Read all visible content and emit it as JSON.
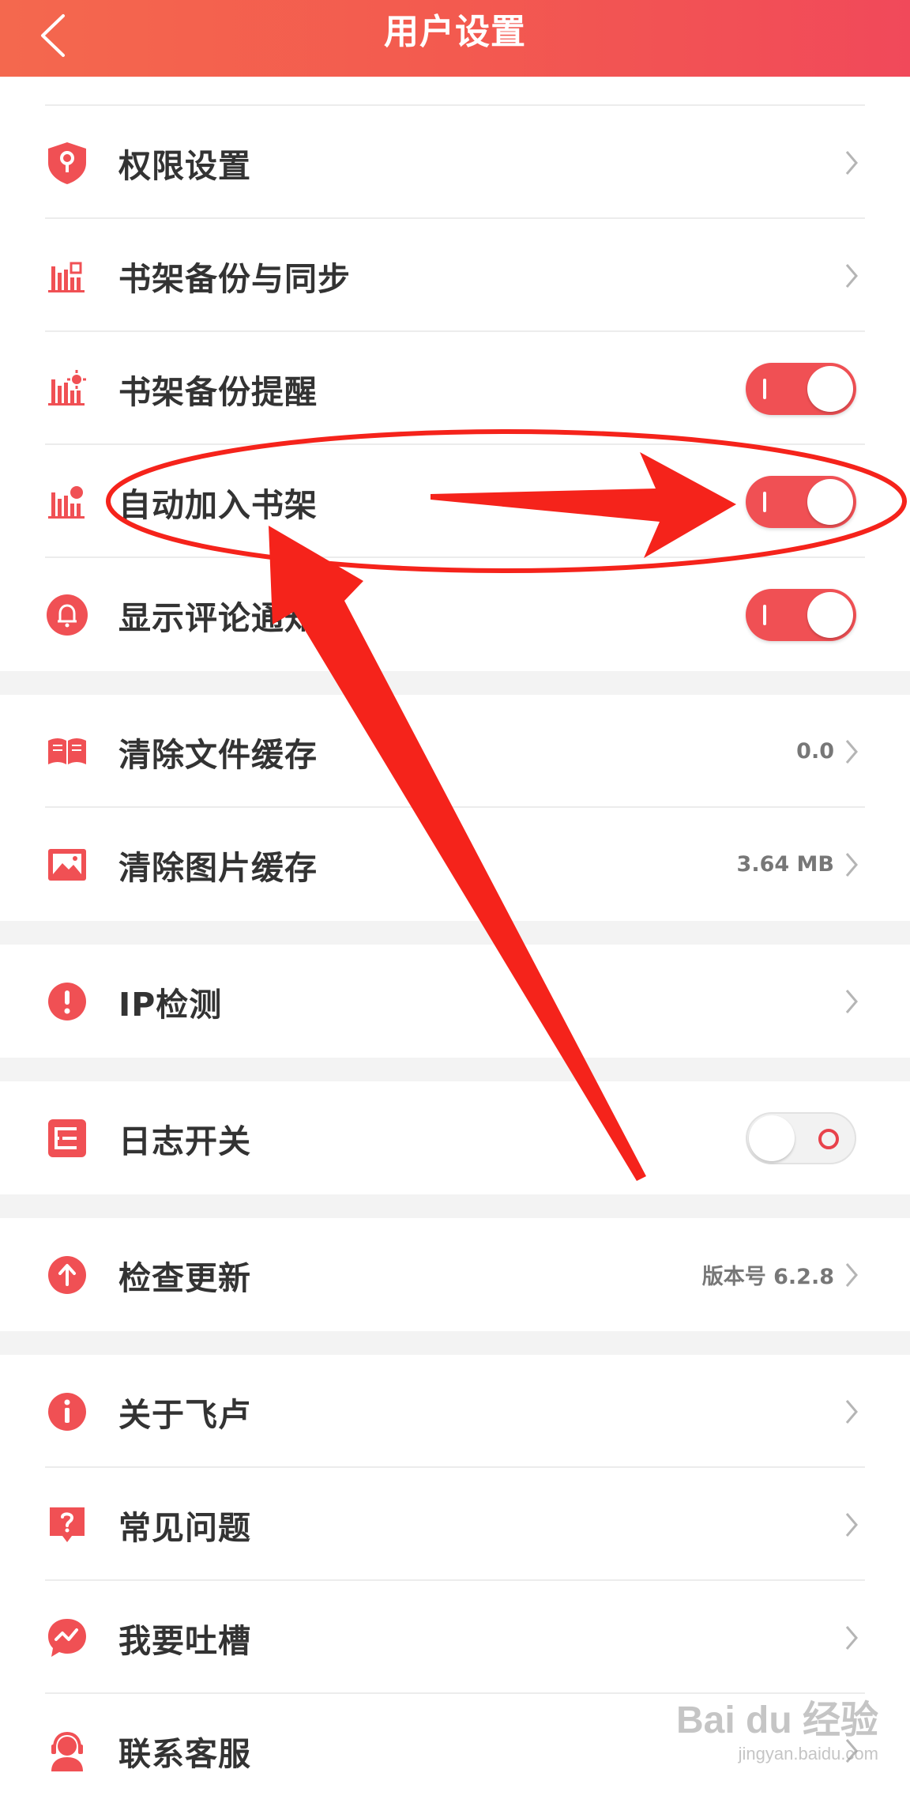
{
  "header": {
    "title": "用户设置"
  },
  "groups": [
    {
      "items": [
        {
          "label": "权限设置",
          "icon": "shield-key-icon",
          "type": "link"
        },
        {
          "label": "书架备份与同步",
          "icon": "bookshelf-sync-icon",
          "type": "link"
        },
        {
          "label": "书架备份提醒",
          "icon": "bookshelf-reminder-icon",
          "type": "toggle",
          "on": true
        },
        {
          "label": "自动加入书架",
          "icon": "bookshelf-add-icon",
          "type": "toggle",
          "on": true
        },
        {
          "label": "显示评论通知",
          "icon": "bell-icon",
          "type": "toggle",
          "on": true
        }
      ]
    },
    {
      "items": [
        {
          "label": "清除文件缓存",
          "icon": "book-open-icon",
          "type": "link",
          "value": "0.0"
        },
        {
          "label": "清除图片缓存",
          "icon": "image-icon",
          "type": "link",
          "value": "3.64 MB"
        }
      ]
    },
    {
      "items": [
        {
          "label": "IP检测",
          "icon": "alert-circle-icon",
          "type": "link"
        }
      ]
    },
    {
      "items": [
        {
          "label": "日志开关",
          "icon": "log-icon",
          "type": "toggle",
          "on": false
        }
      ]
    },
    {
      "items": [
        {
          "label": "检查更新",
          "icon": "update-arrow-icon",
          "type": "link",
          "value": "版本号 6.2.8"
        }
      ]
    },
    {
      "items": [
        {
          "label": "关于飞卢",
          "icon": "info-icon",
          "type": "link"
        },
        {
          "label": "常见问题",
          "icon": "question-icon",
          "type": "link"
        },
        {
          "label": "我要吐槽",
          "icon": "feedback-icon",
          "type": "link"
        },
        {
          "label": "联系客服",
          "icon": "customer-service-icon",
          "type": "link"
        }
      ]
    }
  ],
  "colors": {
    "accent": "#f05054",
    "header_start": "#f4684e",
    "header_end": "#f1495a",
    "annotation": "#f5231b"
  },
  "watermark": {
    "main": "Bai du 经验",
    "sub": "jingyan.baidu.com"
  }
}
